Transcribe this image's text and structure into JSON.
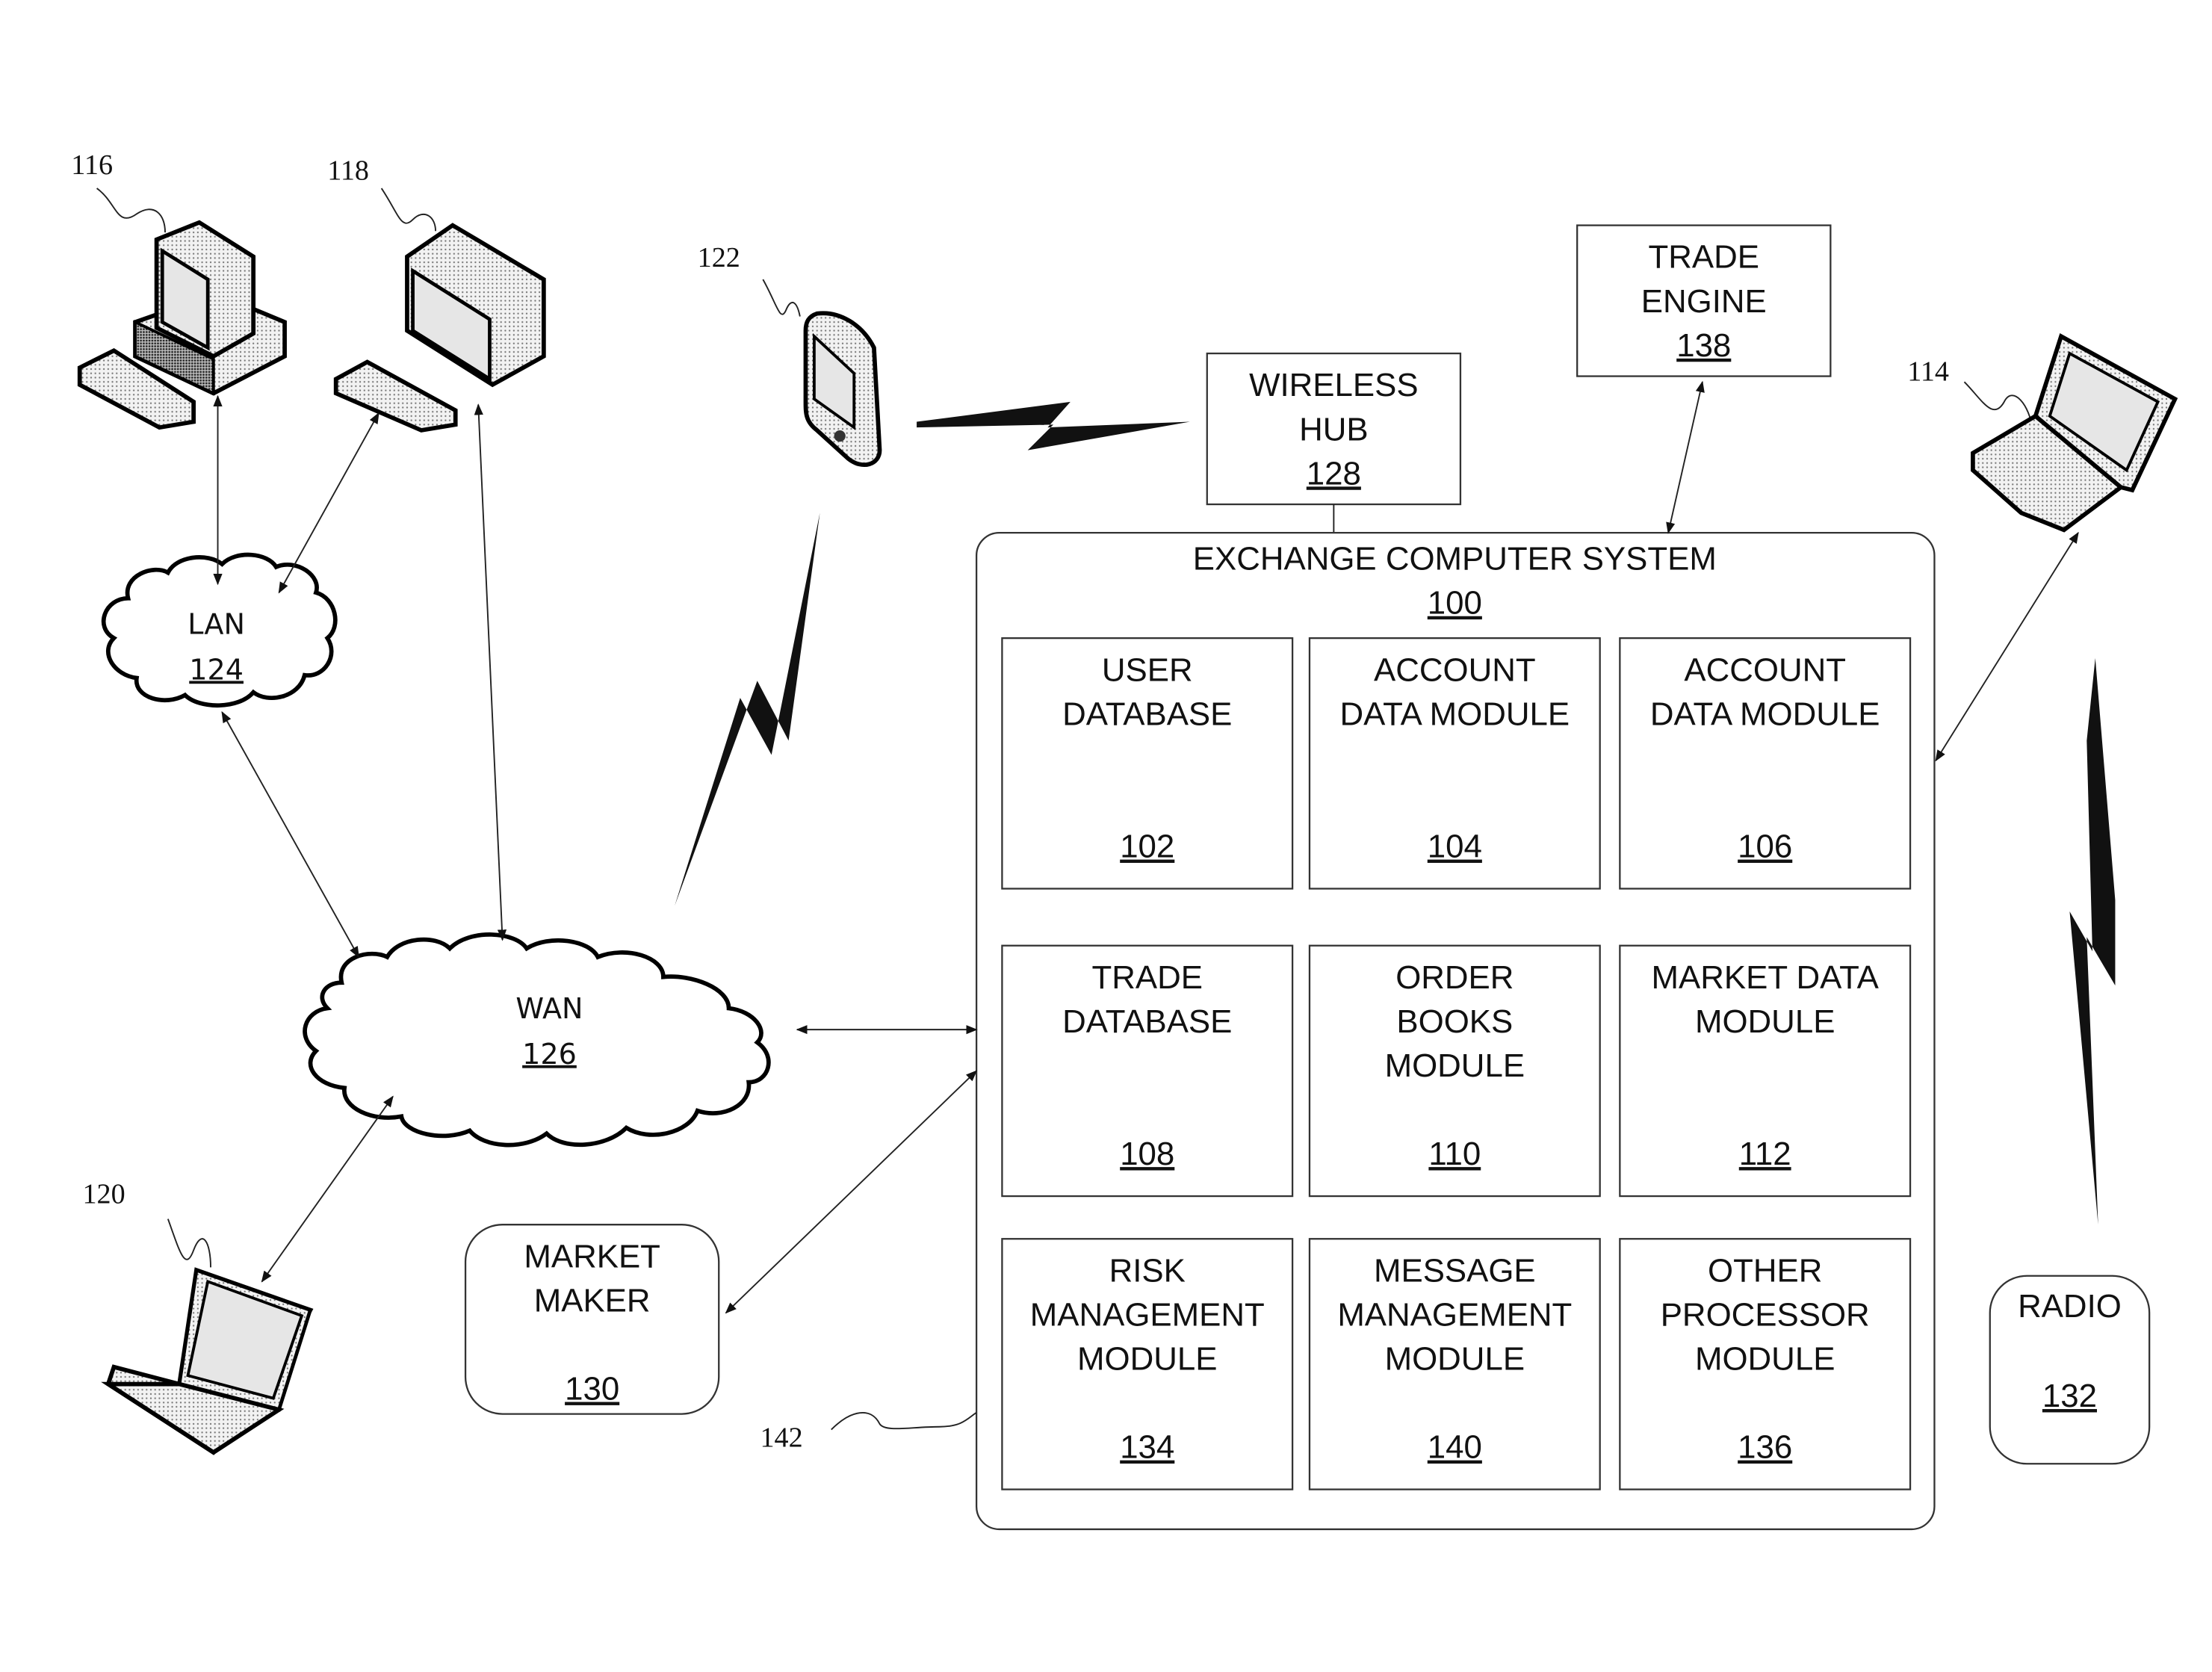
{
  "diagram": {
    "devices": [
      {
        "id": "116",
        "kind": "desktop-computer"
      },
      {
        "id": "118",
        "kind": "desktop-computer"
      },
      {
        "id": "122",
        "kind": "pda-handheld"
      },
      {
        "id": "114",
        "kind": "laptop"
      },
      {
        "id": "120",
        "kind": "laptop"
      }
    ],
    "networks": {
      "lan": {
        "label": "LAN",
        "ref": "124"
      },
      "wan": {
        "label": "WAN",
        "ref": "126"
      }
    },
    "wireless_hub": {
      "lines": [
        "WIRELESS",
        "HUB"
      ],
      "ref": "128"
    },
    "trade_engine": {
      "lines": [
        "TRADE",
        "ENGINE"
      ],
      "ref": "138"
    },
    "market_maker": {
      "lines": [
        "MARKET",
        "MAKER"
      ],
      "ref": "130"
    },
    "radio": {
      "lines": [
        "RADIO"
      ],
      "ref": "132"
    },
    "exchange": {
      "title": "EXCHANGE COMPUTER SYSTEM",
      "ref": "100",
      "bus_ref": "142",
      "modules": [
        {
          "lines": [
            "USER",
            "DATABASE"
          ],
          "ref": "102"
        },
        {
          "lines": [
            "ACCOUNT",
            "DATA MODULE"
          ],
          "ref": "104"
        },
        {
          "lines": [
            "ACCOUNT",
            "DATA MODULE"
          ],
          "ref": "106"
        },
        {
          "lines": [
            "TRADE",
            "DATABASE"
          ],
          "ref": "108"
        },
        {
          "lines": [
            "ORDER",
            "BOOKS",
            "MODULE"
          ],
          "ref": "110"
        },
        {
          "lines": [
            "MARKET DATA",
            "MODULE"
          ],
          "ref": "112"
        },
        {
          "lines": [
            "RISK",
            "MANAGEMENT",
            "MODULE"
          ],
          "ref": "134"
        },
        {
          "lines": [
            "MESSAGE",
            "MANAGEMENT",
            "MODULE"
          ],
          "ref": "140"
        },
        {
          "lines": [
            "OTHER",
            "PROCESSOR",
            "MODULE"
          ],
          "ref": "136"
        }
      ]
    }
  }
}
